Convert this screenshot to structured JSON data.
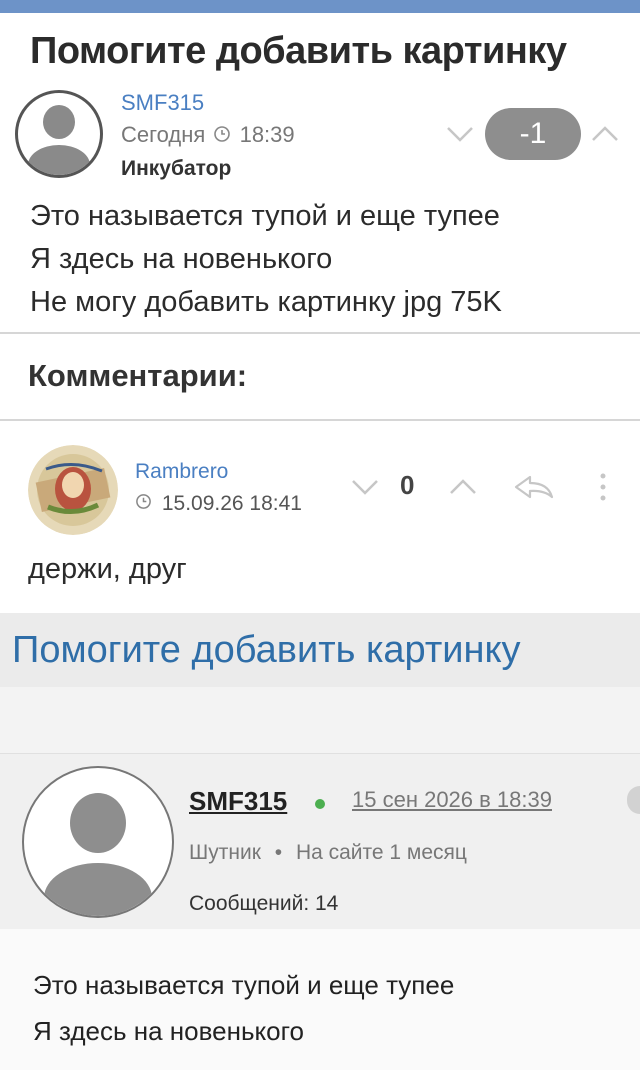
{
  "post": {
    "title": "Помогите добавить картинку",
    "author": "SMF315",
    "date": "Сегодня",
    "time": "18:39",
    "rank": "Инкубатор",
    "score": "-1",
    "body_lines": [
      "Это называется тупой и еще тупее",
      "Я здесь на новенького",
      "Не могу добавить картинку jpg 75K"
    ]
  },
  "comments": {
    "heading": "Комментарии:",
    "items": [
      {
        "author": "Rambrero",
        "datetime": "15.09.26 18:41",
        "score": "0",
        "text": "держи, друг",
        "attachment": {
          "title": "Помогите добавить картинку",
          "author": "SMF315",
          "date": "15 сен 2026 в 18:39",
          "status": "Шутник",
          "membership": "На сайте 1 месяц",
          "separator": "•",
          "posts": "Сообщений: 14",
          "body_lines": [
            "Это называется тупой и еще тупее",
            "Я здесь на новенького"
          ]
        }
      }
    ]
  },
  "icons": {
    "vote_down": "chevron-down-icon",
    "vote_up": "chevron-up-icon",
    "reply": "reply-icon",
    "more": "more-vertical-icon",
    "clock": "clock-icon"
  },
  "colors": {
    "topbar": "#6d93c8",
    "link": "#4a7fc2",
    "score_pill": "#8e8e8e",
    "online": "#4caf50"
  }
}
